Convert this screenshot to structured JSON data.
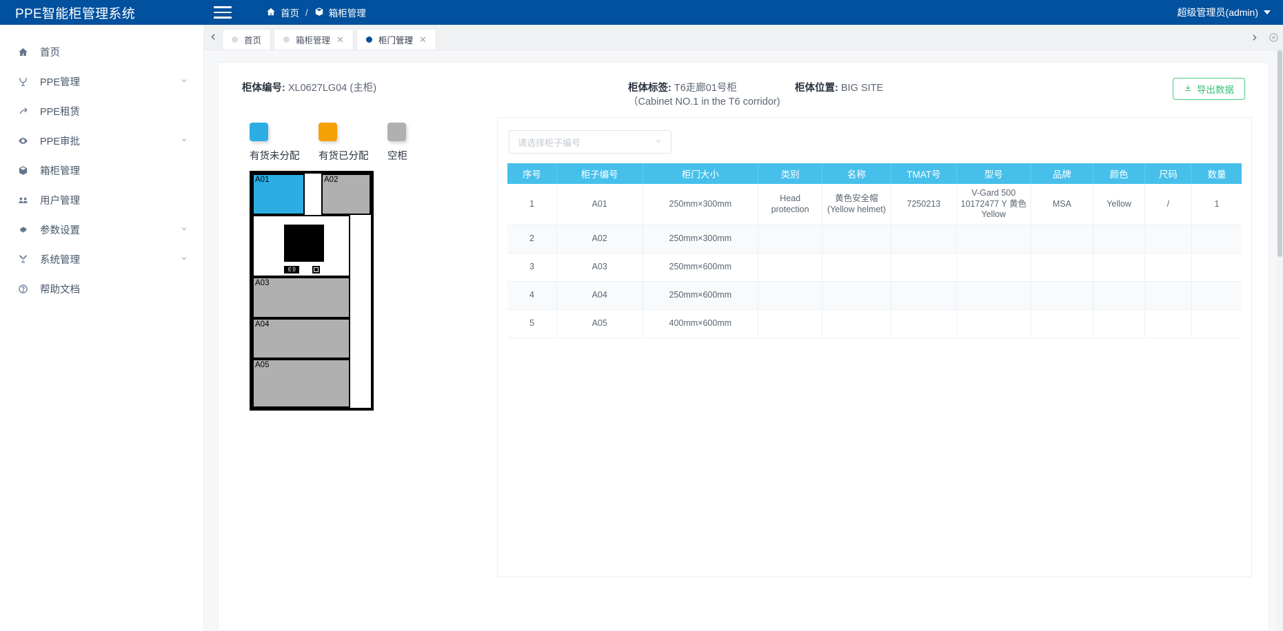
{
  "header": {
    "brand": "PPE智能柜管理系统",
    "menu_icon": "hamburger-icon",
    "breadcrumb": {
      "home": "首页",
      "sep": "/",
      "current": "箱柜管理"
    },
    "user": "超级管理员(admin)",
    "bg_color": "#02519e"
  },
  "sidebar": {
    "items": [
      {
        "label": "首页",
        "icon": "home-icon",
        "expandable": false
      },
      {
        "label": "PPE管理",
        "icon": "ppe-icon",
        "expandable": true
      },
      {
        "label": "PPE租赁",
        "icon": "arrow-icon",
        "expandable": false
      },
      {
        "label": "PPE审批",
        "icon": "eye-icon",
        "expandable": true
      },
      {
        "label": "箱柜管理",
        "icon": "box-icon",
        "expandable": false
      },
      {
        "label": "用户管理",
        "icon": "users-icon",
        "expandable": false
      },
      {
        "label": "参数设置",
        "icon": "gear-icon",
        "expandable": true
      },
      {
        "label": "系统管理",
        "icon": "tools-icon",
        "expandable": true
      },
      {
        "label": "帮助文档",
        "icon": "help-icon",
        "expandable": false
      }
    ]
  },
  "tabs": {
    "prev_icon": "chevron-left-icon",
    "next_icon": "chevron-right-icon",
    "close_all_icon": "close-circle-icon",
    "items": [
      {
        "label": "首页",
        "active": false,
        "closable": false
      },
      {
        "label": "箱柜管理",
        "active": false,
        "closable": true
      },
      {
        "label": "柜门管理",
        "active": true,
        "closable": true
      }
    ]
  },
  "cabinet_info": {
    "code_label": "柜体编号:",
    "code_value": "XL0627LG04  (主柜)",
    "tag_label": "柜体标签:",
    "tag_value": "T6走廊01号柜（Cabinet NO.1 in the T6 corridor)",
    "location_label": "柜体位置:",
    "location_value": "BIG SITE",
    "export_label": "导出数据",
    "export_icon": "download-icon",
    "export_color": "#36c474"
  },
  "legend": [
    {
      "label": "有货未分配",
      "color": "#2cade4"
    },
    {
      "label": "有货已分配",
      "color": "#f5a007"
    },
    {
      "label": "空柜",
      "color": "#b0b0b0"
    }
  ],
  "cabinet_diagram": {
    "doors": [
      {
        "id": "A01",
        "state": "有货未分配",
        "color": "#2cade4"
      },
      {
        "id": "A02",
        "state": "空柜",
        "color": "#b0b0b0"
      },
      {
        "id": "A03",
        "state": "空柜",
        "color": "#b0b0b0"
      },
      {
        "id": "A04",
        "state": "空柜",
        "color": "#b0b0b0"
      },
      {
        "id": "A05",
        "state": "空柜",
        "color": "#b0b0b0"
      }
    ],
    "screen_label": "screen-panel",
    "rfid_label": "((·))",
    "camera_label": "camera-icon"
  },
  "filter": {
    "placeholder": "请选择柜子编号",
    "value": "",
    "chevron_icon": "chevron-down-icon"
  },
  "table": {
    "header_color": "#46c0eb",
    "columns": [
      "序号",
      "柜子编号",
      "柜门大小",
      "类别",
      "名称",
      "TMAT号",
      "型号",
      "品牌",
      "颜色",
      "尺码",
      "数量"
    ],
    "rows": [
      {
        "序号": "1",
        "柜子编号": "A01",
        "柜门大小": "250mm×300mm",
        "类别": "Head protection",
        "名称": "黄色安全帽 (Yellow helmet)",
        "TMAT号": "7250213",
        "型号": "V-Gard 500 10172477 Y 黄色Yellow",
        "品牌": "MSA",
        "颜色": "Yellow",
        "尺码": "/",
        "数量": "1"
      },
      {
        "序号": "2",
        "柜子编号": "A02",
        "柜门大小": "250mm×300mm",
        "类别": "",
        "名称": "",
        "TMAT号": "",
        "型号": "",
        "品牌": "",
        "颜色": "",
        "尺码": "",
        "数量": ""
      },
      {
        "序号": "3",
        "柜子编号": "A03",
        "柜门大小": "250mm×600mm",
        "类别": "",
        "名称": "",
        "TMAT号": "",
        "型号": "",
        "品牌": "",
        "颜色": "",
        "尺码": "",
        "数量": ""
      },
      {
        "序号": "4",
        "柜子编号": "A04",
        "柜门大小": "250mm×600mm",
        "类别": "",
        "名称": "",
        "TMAT号": "",
        "型号": "",
        "品牌": "",
        "颜色": "",
        "尺码": "",
        "数量": ""
      },
      {
        "序号": "5",
        "柜子编号": "A05",
        "柜门大小": "400mm×600mm",
        "类别": "",
        "名称": "",
        "TMAT号": "",
        "型号": "",
        "品牌": "",
        "颜色": "",
        "尺码": "",
        "数量": ""
      }
    ]
  }
}
